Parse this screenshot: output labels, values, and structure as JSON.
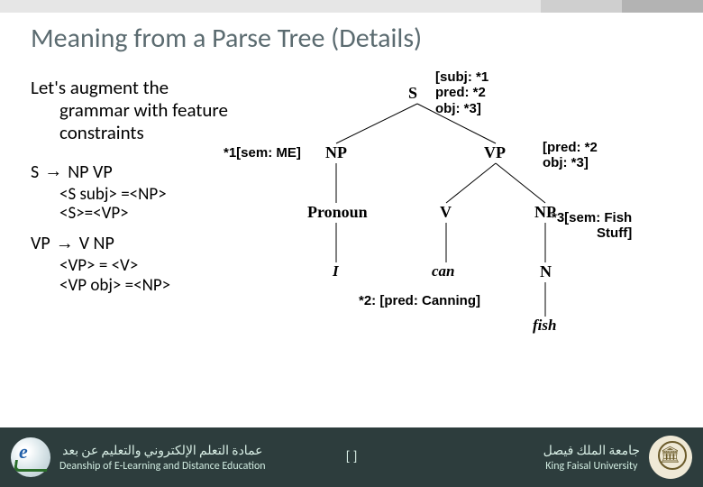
{
  "title": "Meaning from a Parse Tree (Details)",
  "intro": {
    "line1": "Let's augment the",
    "line2": "grammar with feature constraints"
  },
  "rules": {
    "r1": {
      "lhs": "S",
      "rhs": "NP VP",
      "c1": "<S subj> =<NP>",
      "c2": "<S>=<VP>"
    },
    "r2": {
      "lhs": "VP",
      "rhs": "V NP",
      "c1": "<VP> = <V>",
      "c2": "<VP obj> =<NP>"
    }
  },
  "tree": {
    "S": "S",
    "NP1": "NP",
    "VP": "VP",
    "Pronoun": "Pronoun",
    "V": "V",
    "NP2": "NP",
    "N": "N",
    "w_I": "I",
    "w_can": "can",
    "w_fish": "fish"
  },
  "annotations": {
    "s_ann_l1": "[subj: *1",
    "s_ann_l2": " pred: *2",
    "s_ann_l3": " obj: *3]",
    "np_ann": "*1[sem: ME]",
    "vp_ann_l1": "[pred: *2",
    "vp_ann_l2": " obj: *3]",
    "v_ann": "*2: [pred: Canning]",
    "np2_ann_l1": "*3[sem: Fish",
    "np2_ann_l2": "Stuff]"
  },
  "footer": {
    "left_ar": "عمادة التعلم الإلكتروني والتعليم عن بعد",
    "left_en": "Deanship of E-Learning and Distance Education",
    "center": "[    ]",
    "right_ar": "جامعة الملك فيصل",
    "right_en": "King Faisal University"
  }
}
